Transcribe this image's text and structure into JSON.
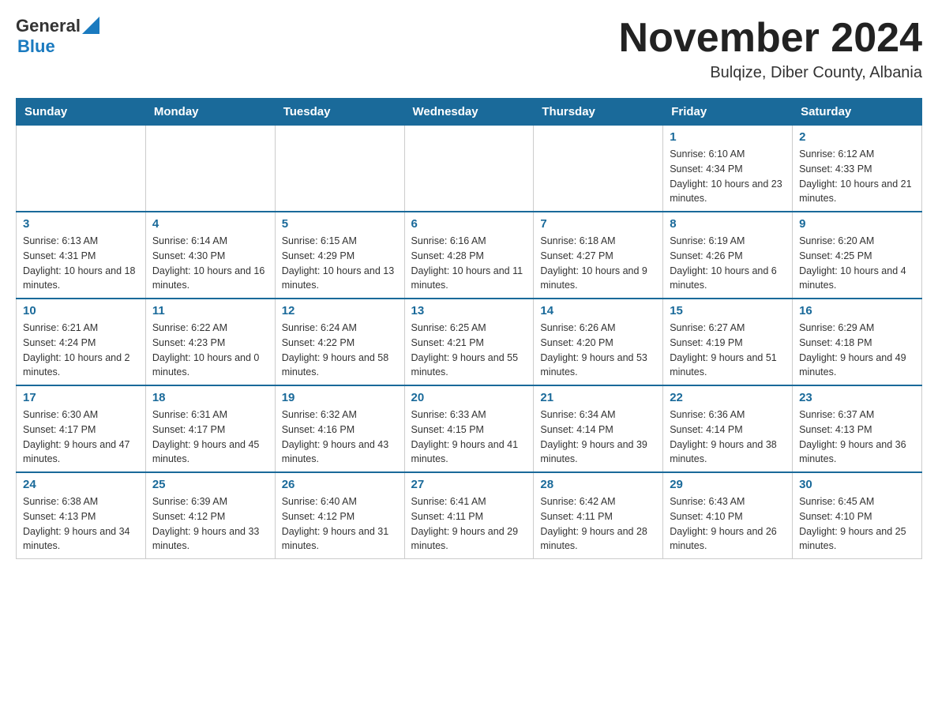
{
  "header": {
    "logo_general": "General",
    "logo_blue": "Blue",
    "month_title": "November 2024",
    "subtitle": "Bulqize, Diber County, Albania"
  },
  "weekdays": [
    "Sunday",
    "Monday",
    "Tuesday",
    "Wednesday",
    "Thursday",
    "Friday",
    "Saturday"
  ],
  "weeks": [
    [
      {
        "day": "",
        "info": ""
      },
      {
        "day": "",
        "info": ""
      },
      {
        "day": "",
        "info": ""
      },
      {
        "day": "",
        "info": ""
      },
      {
        "day": "",
        "info": ""
      },
      {
        "day": "1",
        "info": "Sunrise: 6:10 AM\nSunset: 4:34 PM\nDaylight: 10 hours and 23 minutes."
      },
      {
        "day": "2",
        "info": "Sunrise: 6:12 AM\nSunset: 4:33 PM\nDaylight: 10 hours and 21 minutes."
      }
    ],
    [
      {
        "day": "3",
        "info": "Sunrise: 6:13 AM\nSunset: 4:31 PM\nDaylight: 10 hours and 18 minutes."
      },
      {
        "day": "4",
        "info": "Sunrise: 6:14 AM\nSunset: 4:30 PM\nDaylight: 10 hours and 16 minutes."
      },
      {
        "day": "5",
        "info": "Sunrise: 6:15 AM\nSunset: 4:29 PM\nDaylight: 10 hours and 13 minutes."
      },
      {
        "day": "6",
        "info": "Sunrise: 6:16 AM\nSunset: 4:28 PM\nDaylight: 10 hours and 11 minutes."
      },
      {
        "day": "7",
        "info": "Sunrise: 6:18 AM\nSunset: 4:27 PM\nDaylight: 10 hours and 9 minutes."
      },
      {
        "day": "8",
        "info": "Sunrise: 6:19 AM\nSunset: 4:26 PM\nDaylight: 10 hours and 6 minutes."
      },
      {
        "day": "9",
        "info": "Sunrise: 6:20 AM\nSunset: 4:25 PM\nDaylight: 10 hours and 4 minutes."
      }
    ],
    [
      {
        "day": "10",
        "info": "Sunrise: 6:21 AM\nSunset: 4:24 PM\nDaylight: 10 hours and 2 minutes."
      },
      {
        "day": "11",
        "info": "Sunrise: 6:22 AM\nSunset: 4:23 PM\nDaylight: 10 hours and 0 minutes."
      },
      {
        "day": "12",
        "info": "Sunrise: 6:24 AM\nSunset: 4:22 PM\nDaylight: 9 hours and 58 minutes."
      },
      {
        "day": "13",
        "info": "Sunrise: 6:25 AM\nSunset: 4:21 PM\nDaylight: 9 hours and 55 minutes."
      },
      {
        "day": "14",
        "info": "Sunrise: 6:26 AM\nSunset: 4:20 PM\nDaylight: 9 hours and 53 minutes."
      },
      {
        "day": "15",
        "info": "Sunrise: 6:27 AM\nSunset: 4:19 PM\nDaylight: 9 hours and 51 minutes."
      },
      {
        "day": "16",
        "info": "Sunrise: 6:29 AM\nSunset: 4:18 PM\nDaylight: 9 hours and 49 minutes."
      }
    ],
    [
      {
        "day": "17",
        "info": "Sunrise: 6:30 AM\nSunset: 4:17 PM\nDaylight: 9 hours and 47 minutes."
      },
      {
        "day": "18",
        "info": "Sunrise: 6:31 AM\nSunset: 4:17 PM\nDaylight: 9 hours and 45 minutes."
      },
      {
        "day": "19",
        "info": "Sunrise: 6:32 AM\nSunset: 4:16 PM\nDaylight: 9 hours and 43 minutes."
      },
      {
        "day": "20",
        "info": "Sunrise: 6:33 AM\nSunset: 4:15 PM\nDaylight: 9 hours and 41 minutes."
      },
      {
        "day": "21",
        "info": "Sunrise: 6:34 AM\nSunset: 4:14 PM\nDaylight: 9 hours and 39 minutes."
      },
      {
        "day": "22",
        "info": "Sunrise: 6:36 AM\nSunset: 4:14 PM\nDaylight: 9 hours and 38 minutes."
      },
      {
        "day": "23",
        "info": "Sunrise: 6:37 AM\nSunset: 4:13 PM\nDaylight: 9 hours and 36 minutes."
      }
    ],
    [
      {
        "day": "24",
        "info": "Sunrise: 6:38 AM\nSunset: 4:13 PM\nDaylight: 9 hours and 34 minutes."
      },
      {
        "day": "25",
        "info": "Sunrise: 6:39 AM\nSunset: 4:12 PM\nDaylight: 9 hours and 33 minutes."
      },
      {
        "day": "26",
        "info": "Sunrise: 6:40 AM\nSunset: 4:12 PM\nDaylight: 9 hours and 31 minutes."
      },
      {
        "day": "27",
        "info": "Sunrise: 6:41 AM\nSunset: 4:11 PM\nDaylight: 9 hours and 29 minutes."
      },
      {
        "day": "28",
        "info": "Sunrise: 6:42 AM\nSunset: 4:11 PM\nDaylight: 9 hours and 28 minutes."
      },
      {
        "day": "29",
        "info": "Sunrise: 6:43 AM\nSunset: 4:10 PM\nDaylight: 9 hours and 26 minutes."
      },
      {
        "day": "30",
        "info": "Sunrise: 6:45 AM\nSunset: 4:10 PM\nDaylight: 9 hours and 25 minutes."
      }
    ]
  ]
}
